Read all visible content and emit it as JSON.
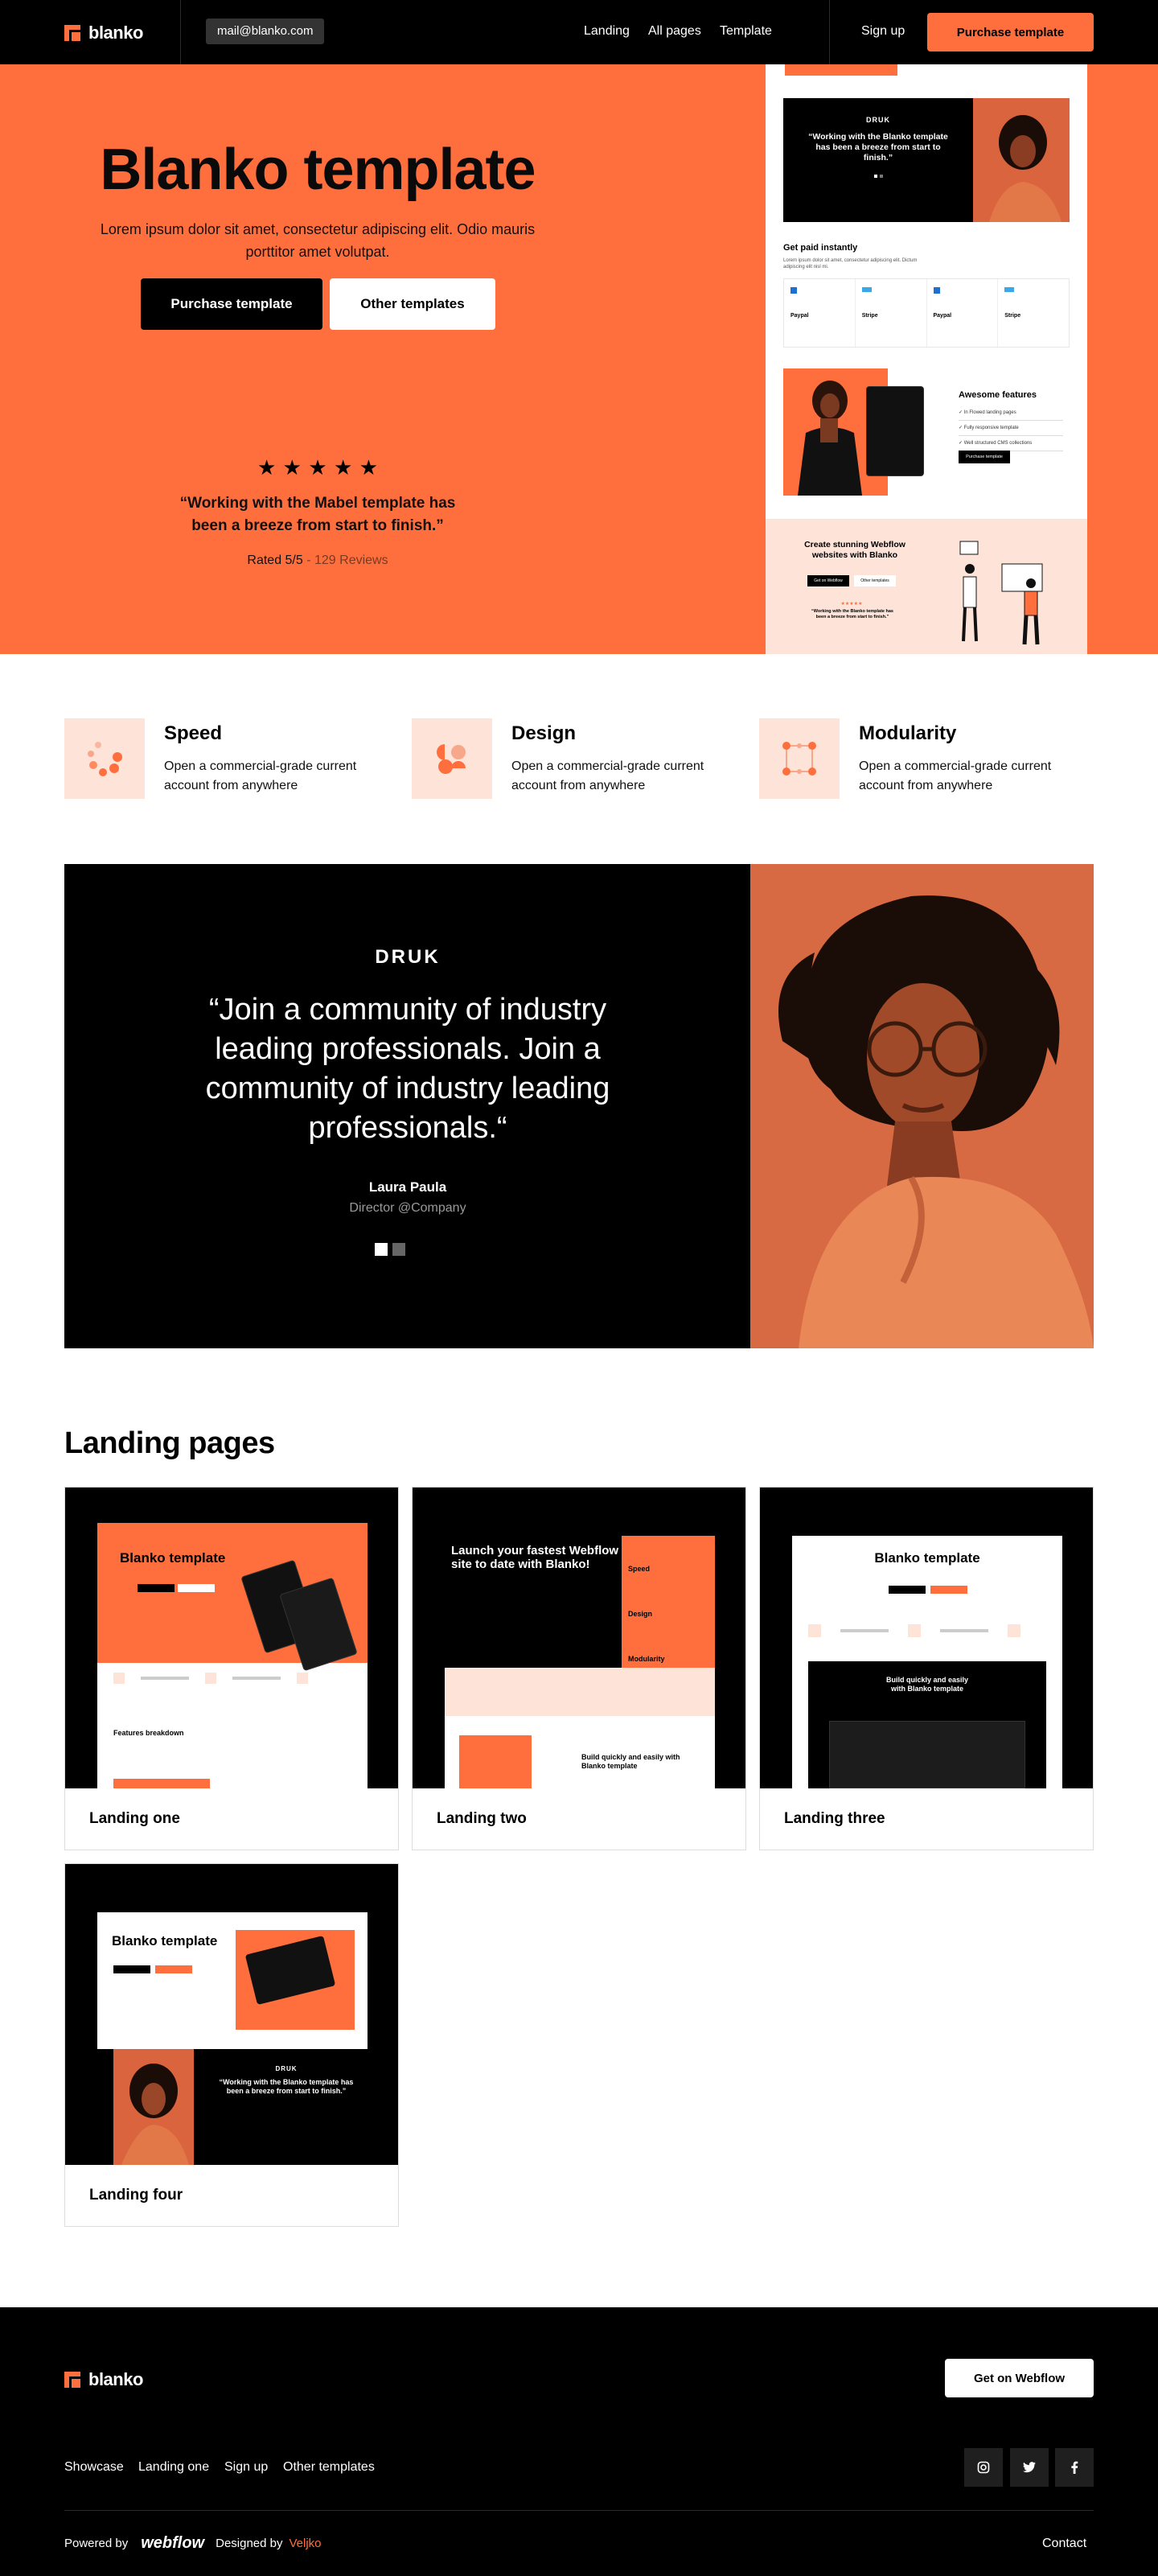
{
  "nav": {
    "logo": "blanko",
    "email": "mail@blanko.com",
    "links": [
      "Landing",
      "All pages",
      "Template"
    ],
    "signup": "Sign up",
    "cta": "Purchase template"
  },
  "hero": {
    "title": "Blanko template",
    "subtitle": "Lorem ipsum dolor sit amet, consectetur adipiscing elit. Odio mauris porttitor amet volutpat.",
    "primary_button": "Purchase template",
    "secondary_button": "Other templates",
    "stars": 5,
    "quote": "“Working with the Mabel template has been a breeze from start to finish.”",
    "rated": "Rated 5/5",
    "reviews": " - 129 Reviews",
    "preview": {
      "brand": "DRUK",
      "quote": "“Working with the Blanko template has been a breeze from start to finish.”",
      "paid_title": "Get paid instantly",
      "paid_text": "Lorem ipsum dolor sit amet, consectetur adipiscing elit. Dictum adipiscing elit nisl mi.",
      "payments": [
        "Paypal",
        "Stripe",
        "Paypal",
        "Stripe"
      ],
      "features_title": "Awesome features",
      "feature_items": [
        "In Flowed landing pages",
        "Fully responsive template",
        "Well structured CMS collections"
      ],
      "features_button": "Purchase template",
      "cta_title": "Create stunning Webflow websites with Blanko",
      "cta_btn1": "Get on Webflow",
      "cta_btn2": "Other templates",
      "cta_quote": "“Working with the Blanko template has been a breeze from start to finish.”"
    }
  },
  "features": [
    {
      "title": "Speed",
      "desc": "Open a commercial-grade current account from anywhere",
      "icon": "speed-dots-icon"
    },
    {
      "title": "Design",
      "desc": "Open a commercial-grade current account from anywhere",
      "icon": "design-circles-icon"
    },
    {
      "title": "Modularity",
      "desc": "Open a commercial-grade current account from anywhere",
      "icon": "modularity-grid-icon"
    }
  ],
  "testimonial": {
    "brand": "DRUK",
    "quote": "“Join a community of industry leading professionals. Join a community of industry leading professionals.“",
    "name": "Laura Paula",
    "role": "Director @Company",
    "slides": 2,
    "active_slide": 1
  },
  "landing": {
    "heading": "Landing pages",
    "cards": [
      {
        "label": "Landing one",
        "preview_title": "Blanko template",
        "preview_section": "Features breakdown"
      },
      {
        "label": "Landing two",
        "preview_title": "Launch your fastest Webflow site to date with Blanko!",
        "preview_items": [
          "Speed",
          "Design",
          "Modularity"
        ],
        "preview_sub": "Build quickly and easily with Blanko template"
      },
      {
        "label": "Landing three",
        "preview_title": "Blanko template",
        "preview_sub": "Build quickly and easily with Blanko template"
      },
      {
        "label": "Landing four",
        "preview_title": "Blanko template",
        "preview_brand": "DRUK",
        "preview_quote": "“Working with the Blanko template has been a breeze from start to finish.”"
      }
    ]
  },
  "footer": {
    "logo": "blanko",
    "cta": "Get on Webflow",
    "links": [
      "Showcase",
      "Landing one",
      "Sign up",
      "Other templates"
    ],
    "social": [
      "instagram-icon",
      "twitter-icon",
      "facebook-icon"
    ],
    "powered_by": "Powered by",
    "webflow": "webflow",
    "designed_by": "Designed by",
    "designer": "Veljko",
    "contact": "Contact"
  },
  "colors": {
    "accent": "#ff6f3e",
    "accent_light": "#fde3d8",
    "dark": "#000000"
  }
}
